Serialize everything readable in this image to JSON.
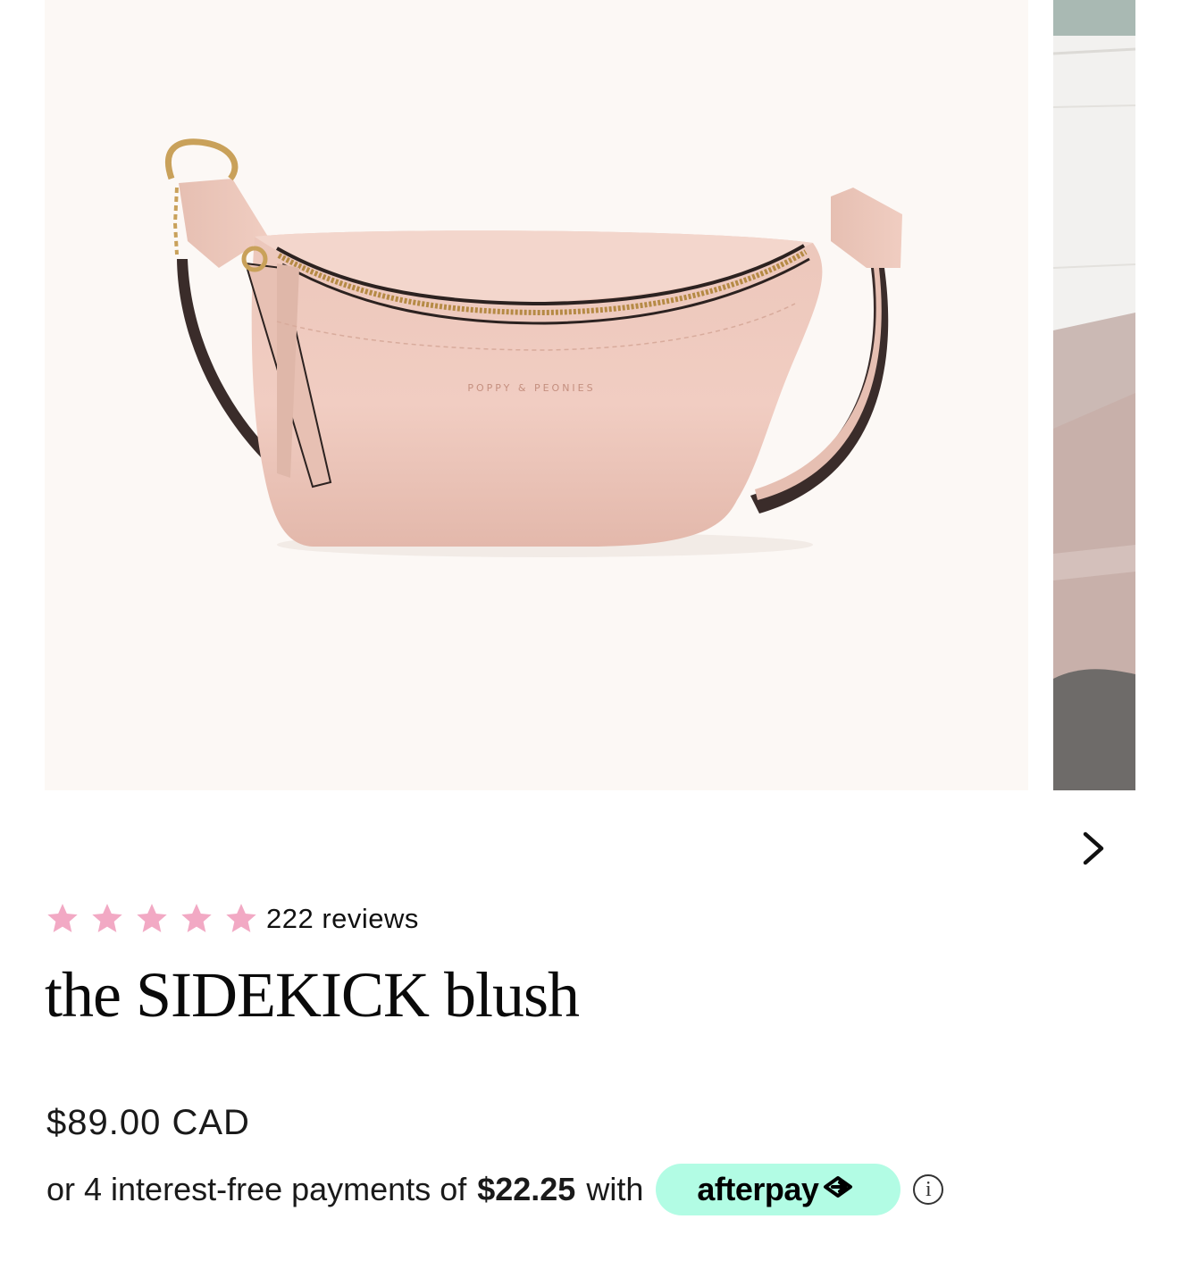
{
  "gallery": {
    "main_image_alt": "the SIDEKICK blush belt bag",
    "bag_imprint": "POPPY & PEONIES",
    "next_label": "Next slide"
  },
  "rating": {
    "stars": 5,
    "max_stars": 5,
    "star_color": "#f2a9c4",
    "reviews_text": "222 reviews"
  },
  "product": {
    "title": "the SIDEKICK blush",
    "price": "$89.00 CAD"
  },
  "afterpay": {
    "prefix": "or 4 interest-free payments of",
    "amount": "$22.25",
    "suffix": "with",
    "brand": "afterpay",
    "badge_color": "#b2fce4",
    "info_icon": "info-icon"
  }
}
